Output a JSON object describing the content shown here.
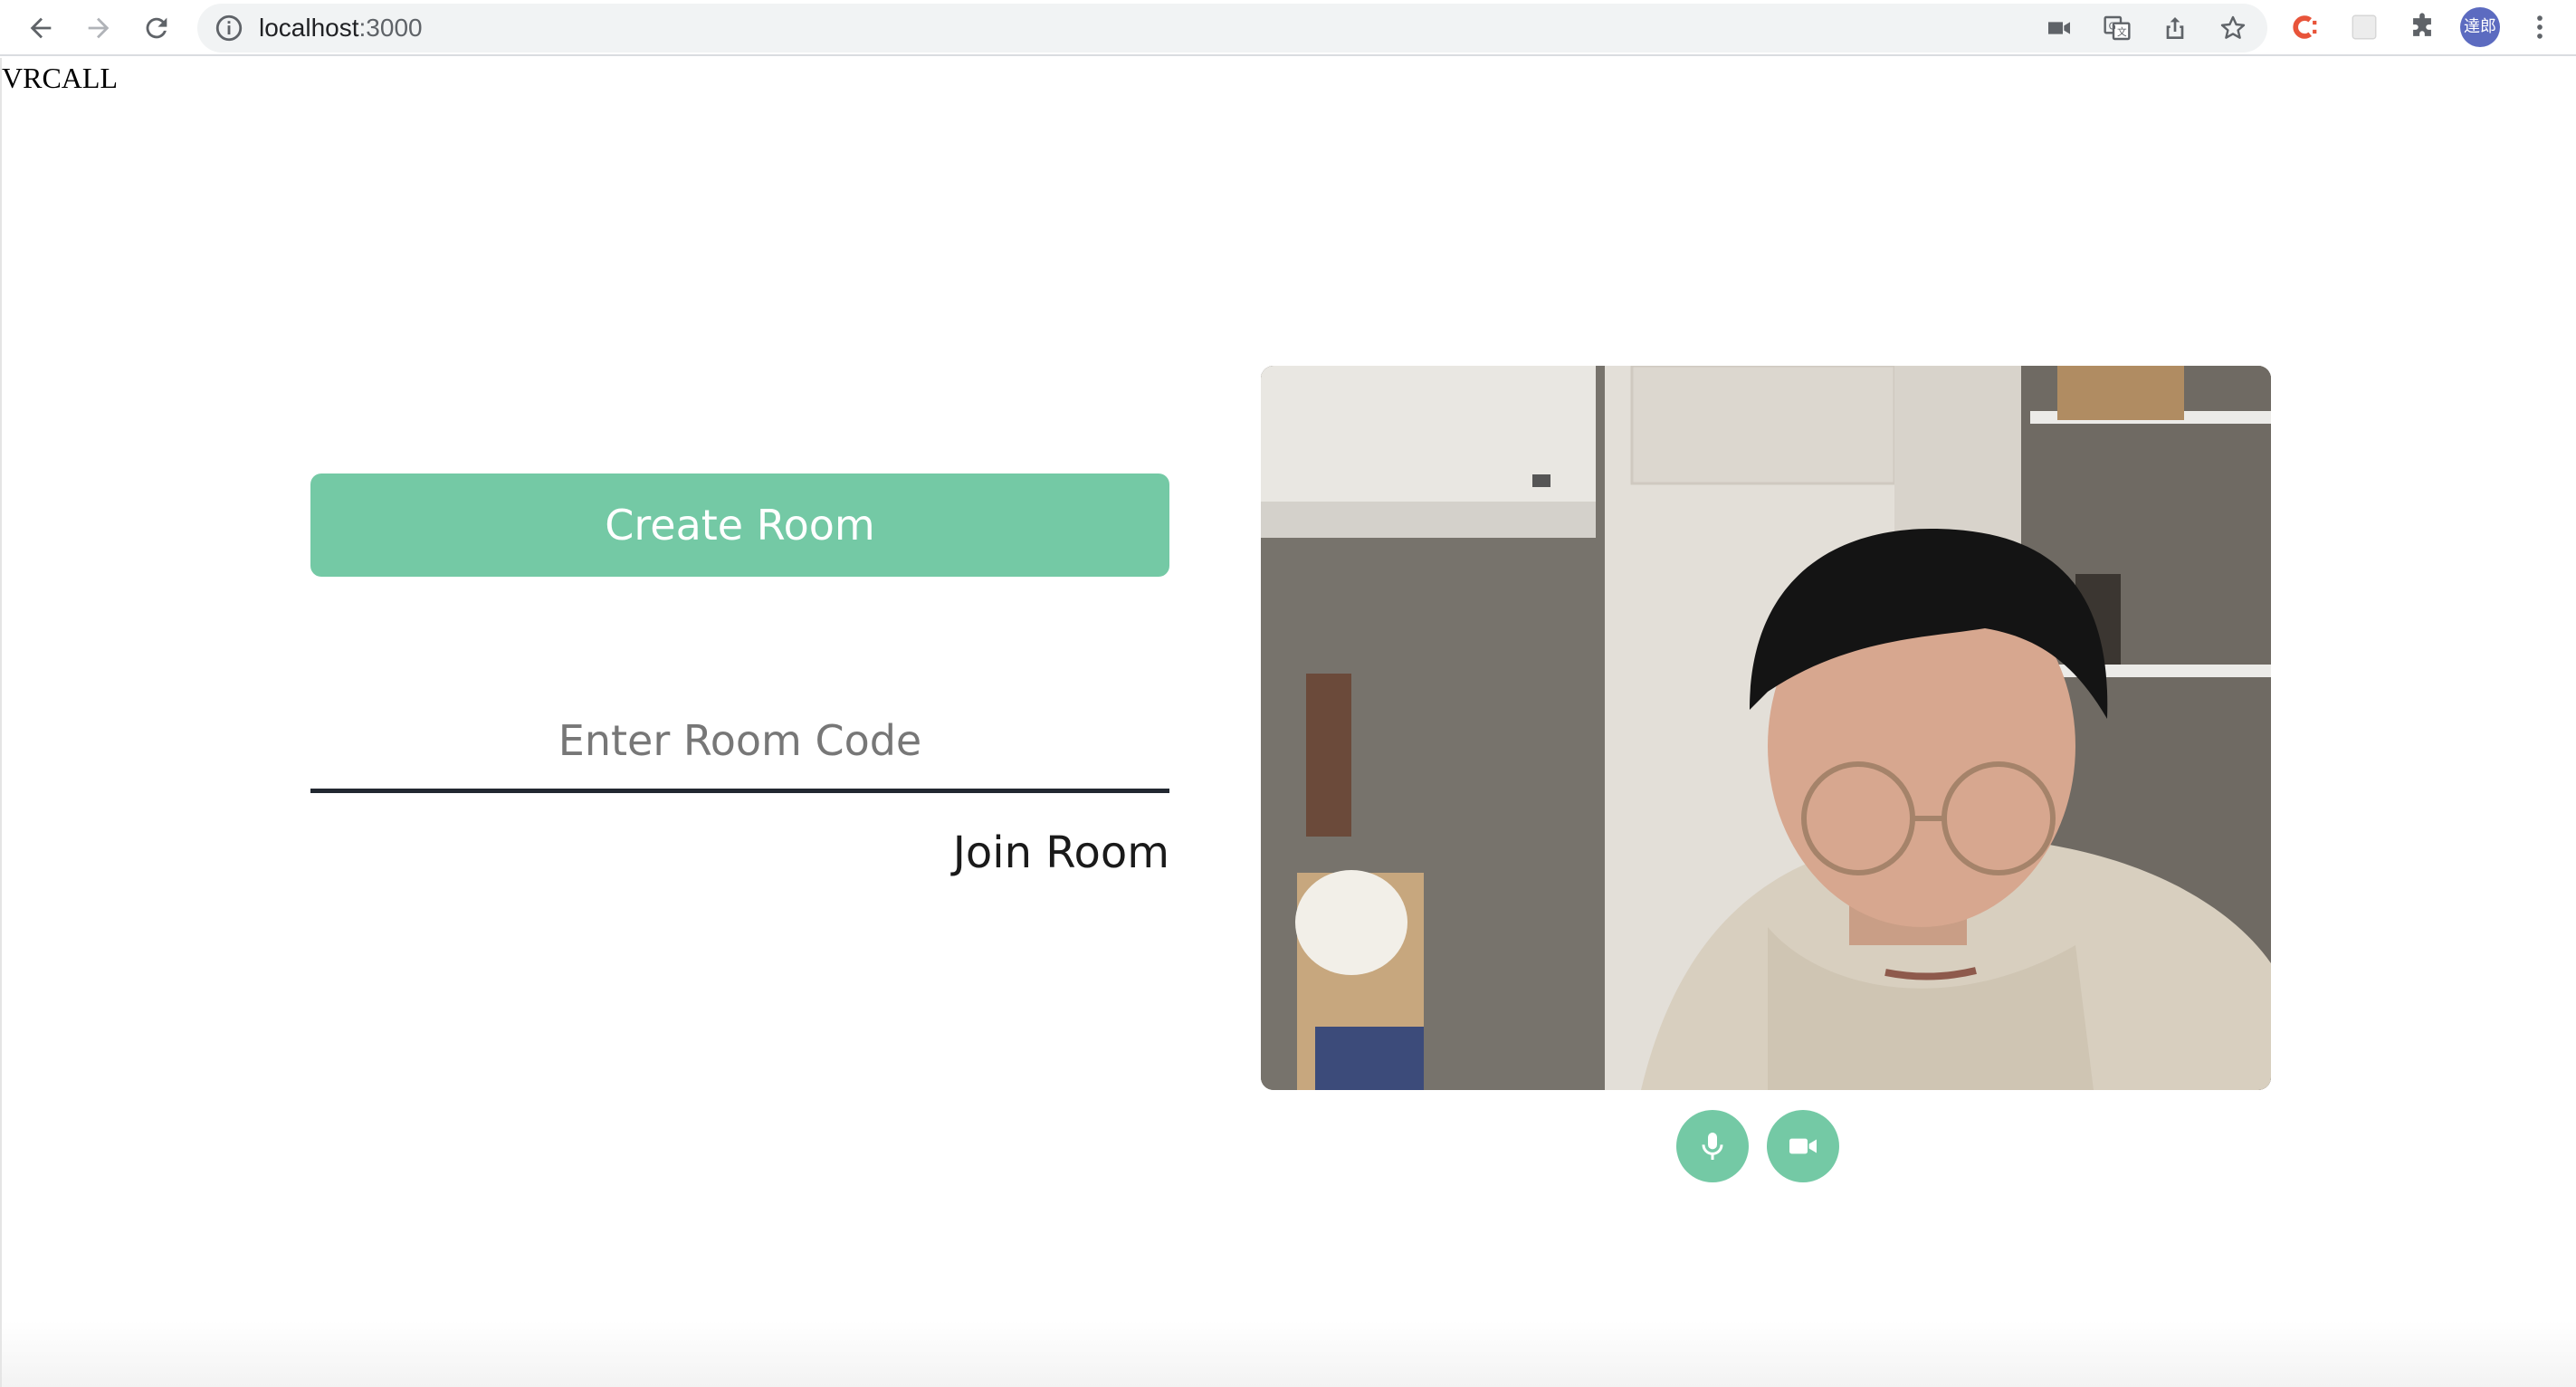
{
  "browser": {
    "url_host": "localhost",
    "url_port": ":3000",
    "profile_initials": "達郎"
  },
  "app": {
    "title": "VRCALL",
    "create_room_label": "Create Room",
    "room_code_placeholder": "Enter Room Code",
    "join_room_label": "Join Room"
  },
  "colors": {
    "accent": "#74c9a5",
    "input_underline": "#222831"
  },
  "controls": {
    "mic_icon": "microphone-icon",
    "camera_icon": "video-camera-icon"
  }
}
